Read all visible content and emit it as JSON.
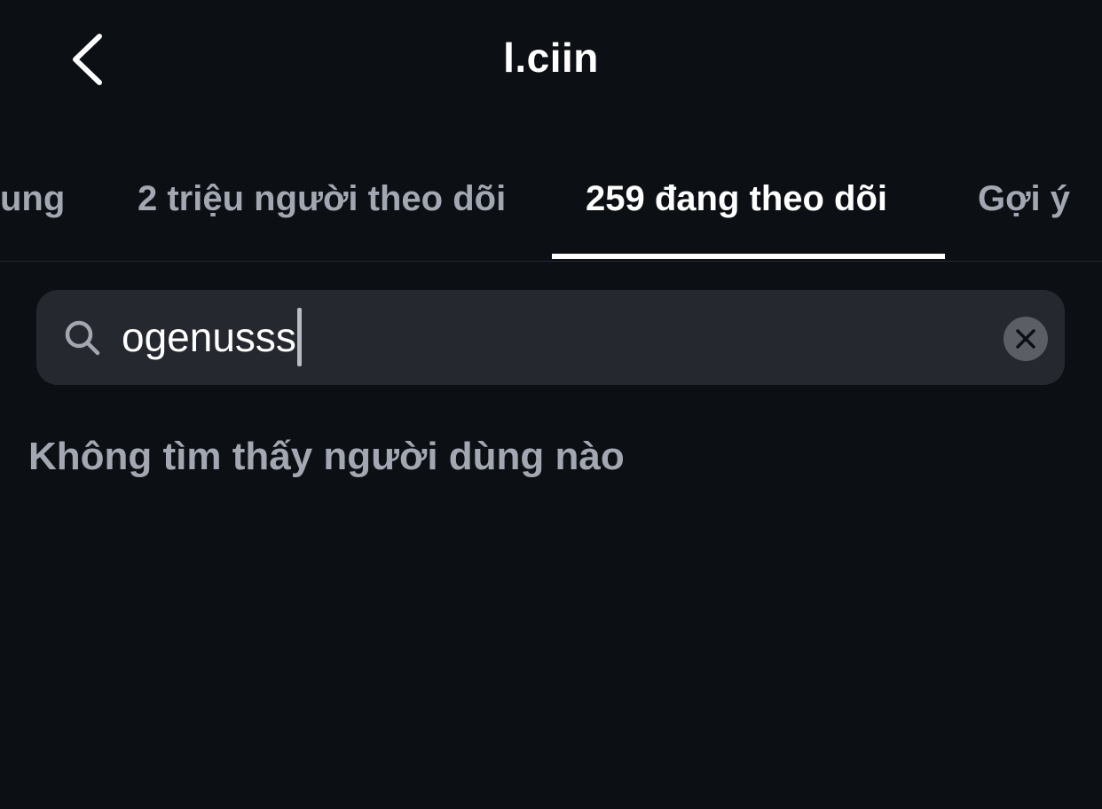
{
  "header": {
    "title": "l.ciin",
    "back_icon": "chevron-left-icon"
  },
  "tabs": [
    {
      "label": "ung",
      "active": false
    },
    {
      "label": "2 triệu người theo dõi",
      "active": false
    },
    {
      "label": "259 đang theo dõi",
      "active": true
    },
    {
      "label": "Gợi ý",
      "active": false
    }
  ],
  "search": {
    "value": "ogenusss",
    "icon": "search-icon",
    "clear_icon": "close-icon"
  },
  "results": {
    "empty_message": "Không tìm thấy người dùng nào"
  },
  "colors": {
    "background": "#0c0f14",
    "search_background": "#25282e",
    "muted_text": "#a2a7b1",
    "active_text": "#ffffff"
  }
}
